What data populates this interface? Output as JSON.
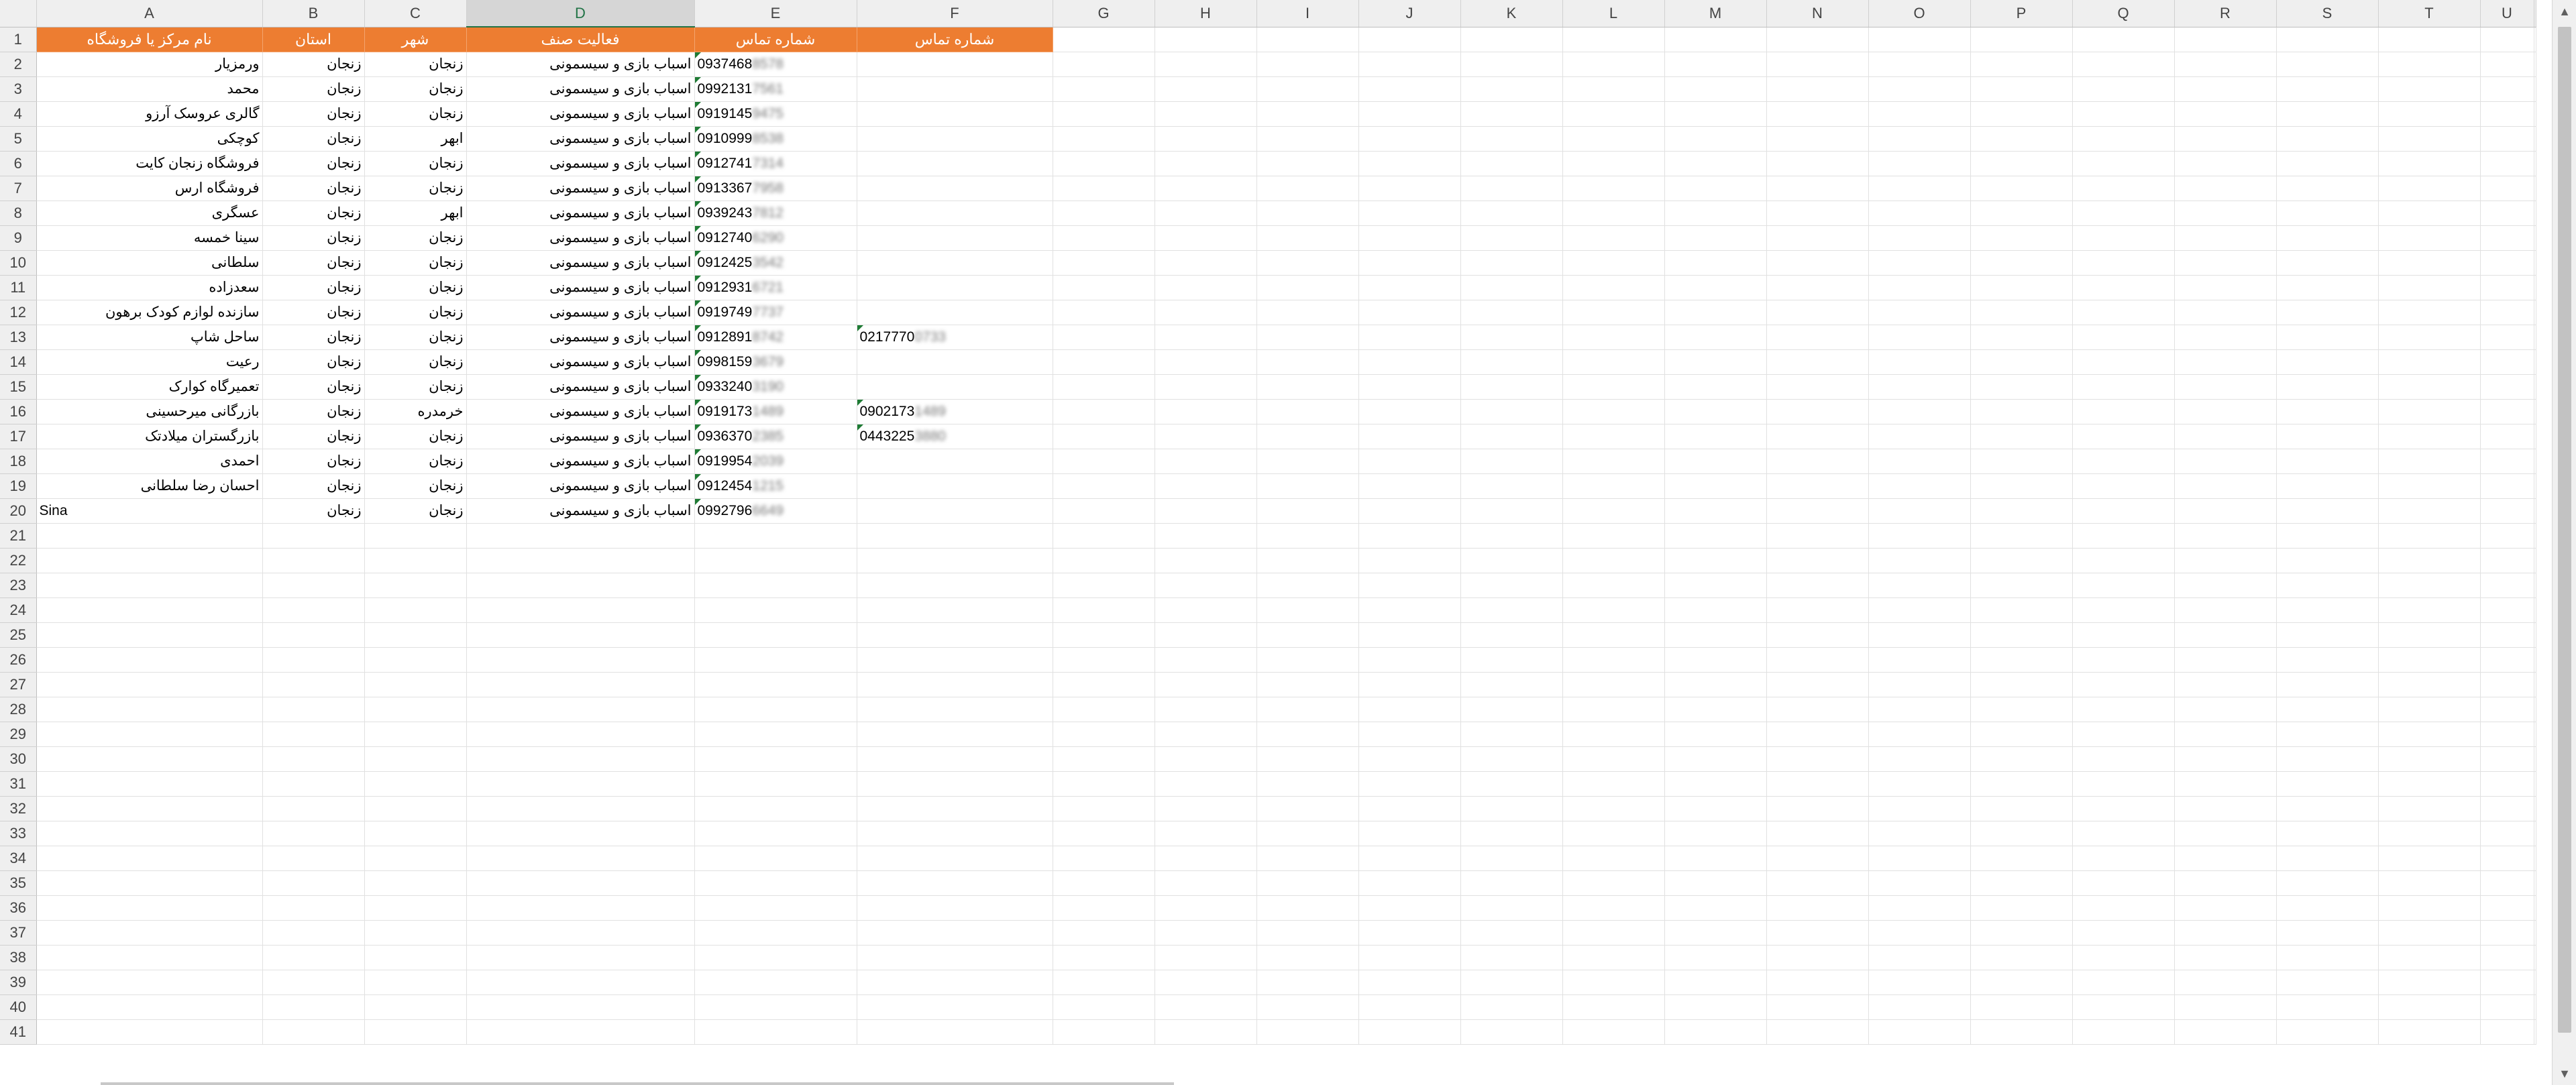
{
  "columns": [
    "A",
    "B",
    "C",
    "D",
    "E",
    "F",
    "G",
    "H",
    "I",
    "J",
    "K",
    "L",
    "M",
    "N",
    "O",
    "P",
    "Q",
    "R",
    "S",
    "T",
    "U"
  ],
  "selected_column": "D",
  "header_row": {
    "name": "نام مرکز یا فروشگاه",
    "province": "استان",
    "city": "شهر",
    "activity": "فعالیت صنف",
    "phone1": "شماره تماس",
    "phone2": "شماره تماس"
  },
  "rows": [
    {
      "name": "ورمزیار",
      "province": "زنجان",
      "city": "زنجان",
      "activity": "اسباب بازی و سیسمونی",
      "phone1": "0937468",
      "phone1_hidden": "8578",
      "phone2": "",
      "phone2_hidden": ""
    },
    {
      "name": "محمد",
      "province": "زنجان",
      "city": "زنجان",
      "activity": "اسباب بازی و سیسمونی",
      "phone1": "0992131",
      "phone1_hidden": "7561",
      "phone2": "",
      "phone2_hidden": ""
    },
    {
      "name": "گالری عروسک آرزو",
      "province": "زنجان",
      "city": "زنجان",
      "activity": "اسباب بازی و سیسمونی",
      "phone1": "0919145",
      "phone1_hidden": "9475",
      "phone2": "",
      "phone2_hidden": ""
    },
    {
      "name": "کوچکی",
      "province": "زنجان",
      "city": "ابهر",
      "activity": "اسباب بازی و سیسمونی",
      "phone1": "0910999",
      "phone1_hidden": "8538",
      "phone2": "",
      "phone2_hidden": ""
    },
    {
      "name": "فروشگاه زنجان کایت",
      "province": "زنجان",
      "city": "زنجان",
      "activity": "اسباب بازی و سیسمونی",
      "phone1": "0912741",
      "phone1_hidden": "7314",
      "phone2": "",
      "phone2_hidden": ""
    },
    {
      "name": "فروشگاه ارس",
      "province": "زنجان",
      "city": "زنجان",
      "activity": "اسباب بازی و سیسمونی",
      "phone1": "0913367",
      "phone1_hidden": "7958",
      "phone2": "",
      "phone2_hidden": ""
    },
    {
      "name": "عسگری",
      "province": "زنجان",
      "city": "ابهر",
      "activity": "اسباب بازی و سیسمونی",
      "phone1": "0939243",
      "phone1_hidden": "7812",
      "phone2": "",
      "phone2_hidden": ""
    },
    {
      "name": "سینا خمسه",
      "province": "زنجان",
      "city": "زنجان",
      "activity": "اسباب بازی و سیسمونی",
      "phone1": "0912740",
      "phone1_hidden": "6290",
      "phone2": "",
      "phone2_hidden": ""
    },
    {
      "name": "سلطانی",
      "province": "زنجان",
      "city": "زنجان",
      "activity": "اسباب بازی و سیسمونی",
      "phone1": "0912425",
      "phone1_hidden": "3542",
      "phone2": "",
      "phone2_hidden": ""
    },
    {
      "name": "سعدزاده",
      "province": "زنجان",
      "city": "زنجان",
      "activity": "اسباب بازی و سیسمونی",
      "phone1": "0912931",
      "phone1_hidden": "6721",
      "phone2": "",
      "phone2_hidden": ""
    },
    {
      "name": "سازنده لوازم کودک برهون",
      "province": "زنجان",
      "city": "زنجان",
      "activity": "اسباب بازی و سیسمونی",
      "phone1": "0919749",
      "phone1_hidden": "7737",
      "phone2": "",
      "phone2_hidden": ""
    },
    {
      "name": "ساحل شاپ",
      "province": "زنجان",
      "city": "زنجان",
      "activity": "اسباب بازی و سیسمونی",
      "phone1": "0912891",
      "phone1_hidden": "8742",
      "phone2": "0217770",
      "phone2_hidden": "0733"
    },
    {
      "name": "رعیت",
      "province": "زنجان",
      "city": "زنجان",
      "activity": "اسباب بازی و سیسمونی",
      "phone1": "0998159",
      "phone1_hidden": "3679",
      "phone2": "",
      "phone2_hidden": ""
    },
    {
      "name": "تعمیرگاه کوارک",
      "province": "زنجان",
      "city": "زنجان",
      "activity": "اسباب بازی و سیسمونی",
      "phone1": "0933240",
      "phone1_hidden": "3190",
      "phone2": "",
      "phone2_hidden": ""
    },
    {
      "name": "بازرگانی میرحسینی",
      "province": "زنجان",
      "city": "خرمدره",
      "activity": "اسباب بازی و سیسمونی",
      "phone1": "0919173",
      "phone1_hidden": "1489",
      "phone2": "0902173",
      "phone2_hidden": "1489"
    },
    {
      "name": "بازرگستران میلادتک",
      "province": "زنجان",
      "city": "زنجان",
      "activity": "اسباب بازی و سیسمونی",
      "phone1": "0936370",
      "phone1_hidden": "2385",
      "phone2": "0443225",
      "phone2_hidden": "3880"
    },
    {
      "name": "احمدی",
      "province": "زنجان",
      "city": "زنجان",
      "activity": "اسباب بازی و سیسمونی",
      "phone1": "0919954",
      "phone1_hidden": "2039",
      "phone2": "",
      "phone2_hidden": ""
    },
    {
      "name": "احسان رضا سلطانی",
      "province": "زنجان",
      "city": "زنجان",
      "activity": "اسباب بازی و سیسمونی",
      "phone1": "0912454",
      "phone1_hidden": "1215",
      "phone2": "",
      "phone2_hidden": ""
    },
    {
      "name": "Sina",
      "province": "زنجان",
      "city": "زنجان",
      "activity": "اسباب بازی و سیسمونی",
      "phone1": "0992796",
      "phone1_hidden": "6649",
      "phone2": "",
      "phone2_hidden": ""
    }
  ],
  "total_rows": 41,
  "colors": {
    "header_fill": "#ed7d31",
    "header_text": "#ffffff",
    "indicator": "#1e7b34",
    "selection": "#217346"
  }
}
